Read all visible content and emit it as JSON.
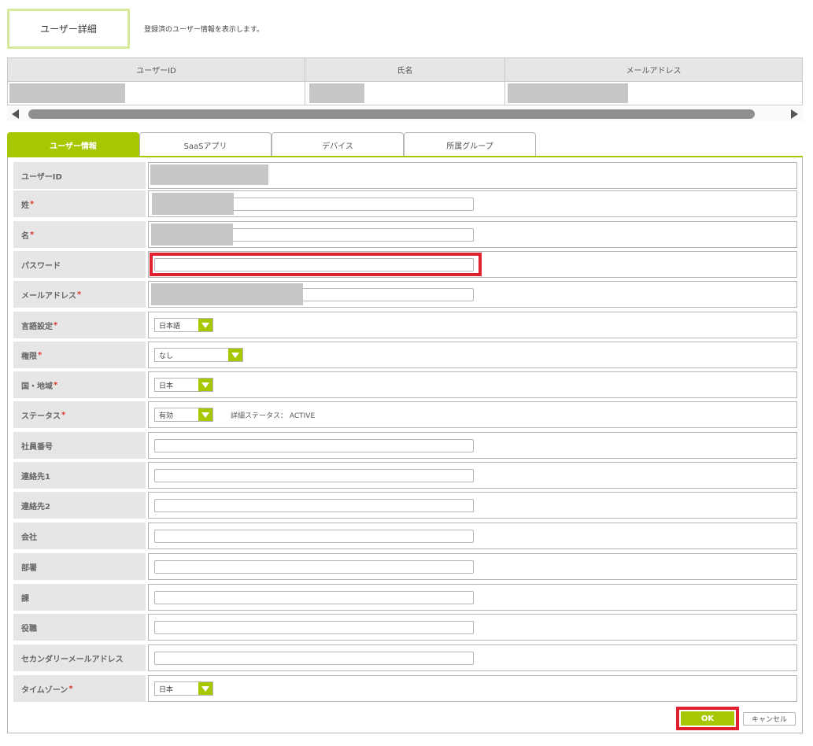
{
  "header": {
    "title": "ユーザー詳細",
    "description": "登録済のユーザー情報を表示します。"
  },
  "summary": {
    "columns": [
      "ユーザーID",
      "氏名",
      "メールアドレス"
    ]
  },
  "tabs": [
    "ユーザー情報",
    "SaaSアプリ",
    "デバイス",
    "所属グループ"
  ],
  "form": {
    "rows": [
      {
        "label": "ユーザーID",
        "required": false
      },
      {
        "label": "姓",
        "required": true
      },
      {
        "label": "名",
        "required": true
      },
      {
        "label": "パスワード",
        "required": false
      },
      {
        "label": "メールアドレス",
        "required": true
      },
      {
        "label": "言語設定",
        "required": true,
        "select": "日本語"
      },
      {
        "label": "権限",
        "required": true,
        "select": "なし"
      },
      {
        "label": "国・地域",
        "required": true,
        "select": "日本"
      },
      {
        "label": "ステータス",
        "required": true,
        "select": "有効",
        "extra": "詳細ステータス： ACTIVE"
      },
      {
        "label": "社員番号",
        "required": false
      },
      {
        "label": "連絡先1",
        "required": false
      },
      {
        "label": "連絡先2",
        "required": false
      },
      {
        "label": "会社",
        "required": false
      },
      {
        "label": "部署",
        "required": false
      },
      {
        "label": "課",
        "required": false
      },
      {
        "label": "役職",
        "required": false
      },
      {
        "label": "セカンダリーメールアドレス",
        "required": false
      },
      {
        "label": "タイムゾーン",
        "required": true,
        "select": "日本"
      }
    ],
    "required_mark": "*"
  },
  "buttons": {
    "ok": "OK",
    "cancel": "キャンセル"
  },
  "colors": {
    "accent": "#a7c700",
    "highlight": "#e0202e",
    "required": "#d9382b"
  }
}
